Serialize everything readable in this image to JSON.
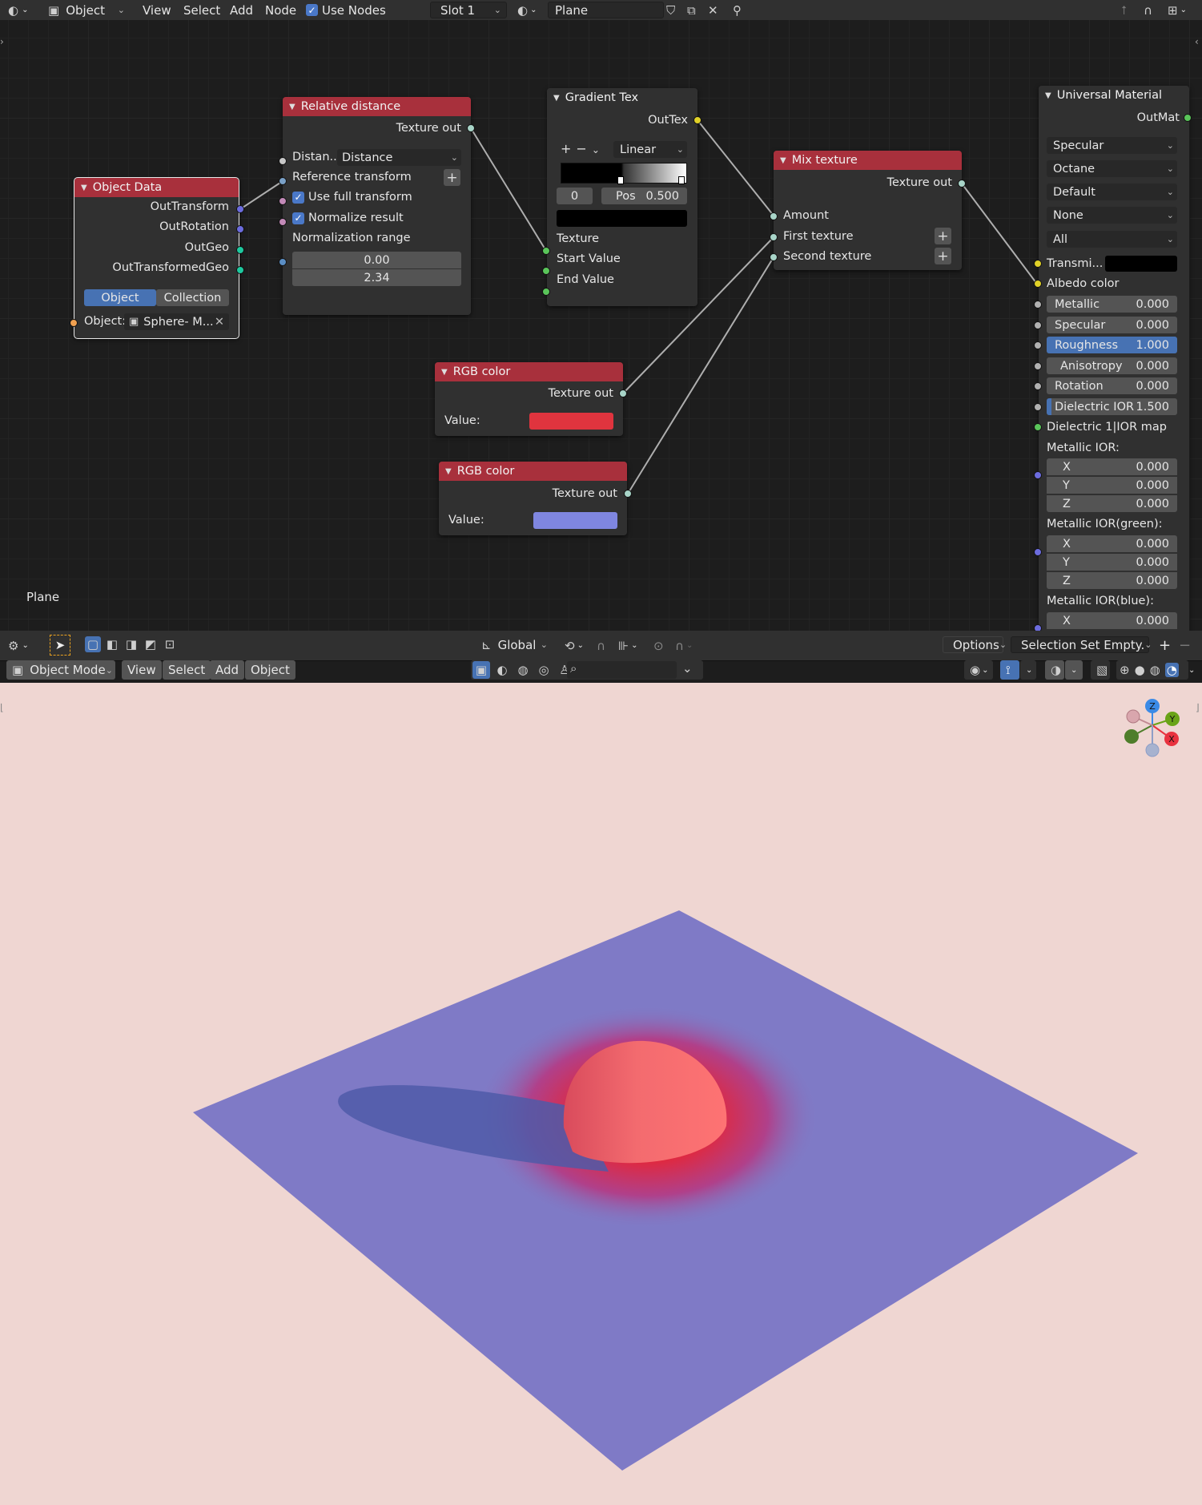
{
  "topbar": {
    "mode_label": "Object",
    "menu": [
      "View",
      "Select",
      "Add",
      "Node"
    ],
    "use_nodes_label": "Use Nodes",
    "slot_label": "Slot 1",
    "material_name": "Plane"
  },
  "node_editor": {
    "object_name_label": "Plane",
    "nodes": {
      "object_data": {
        "title": "Object Data",
        "outputs": [
          "OutTransform",
          "OutRotation",
          "OutGeo",
          "OutTransformedGeo"
        ],
        "tab_object": "Object",
        "tab_collection": "Collection",
        "object_label": "Object:",
        "object_value": "Sphere- M..."
      },
      "relative_distance": {
        "title": "Relative distance",
        "output": "Texture out",
        "distance_label": "Distan...",
        "distance_value": "Distance",
        "reference_transform": "Reference transform",
        "use_full_transform": "Use full transform",
        "normalize_result": "Normalize result",
        "normalization_range": "Normalization range",
        "range_min": "0.00",
        "range_max": "2.34"
      },
      "gradient_tex": {
        "title": "Gradient Tex",
        "output": "OutTex",
        "interp": "Linear",
        "index": "0",
        "pos_label": "Pos",
        "pos_value": "0.500",
        "inputs": [
          "Texture",
          "Start Value",
          "End Value"
        ]
      },
      "mix_texture": {
        "title": "Mix texture",
        "output": "Texture out",
        "inputs": [
          "Amount",
          "First texture",
          "Second texture"
        ]
      },
      "rgb1": {
        "title": "RGB color",
        "output": "Texture out",
        "value_label": "Value:",
        "color": "#e0343e"
      },
      "rgb2": {
        "title": "RGB color",
        "output": "Texture out",
        "value_label": "Value:",
        "color": "#7f86e0"
      },
      "universal": {
        "title": "Universal Material",
        "output": "OutMat",
        "dropdowns": [
          "Specular",
          "Octane",
          "Default",
          "None",
          "All"
        ],
        "transmission_label": "Transmi...",
        "albedo_label": "Albedo color",
        "params": [
          {
            "label": "Metallic",
            "value": "0.000"
          },
          {
            "label": "Specular",
            "value": "0.000"
          },
          {
            "label": "Roughness",
            "value": "1.000"
          },
          {
            "label": "Anisotropy",
            "value": "0.000"
          },
          {
            "label": "Rotation",
            "value": "0.000"
          },
          {
            "label": "Dielectric IOR",
            "value": "1.500"
          }
        ],
        "ior_map_label": "Dielectric 1|IOR map",
        "metallic_ior_label": "Metallic IOR:",
        "metallic_ior_green_label": "Metallic IOR(green):",
        "metallic_ior_blue_label": "Metallic IOR(blue):",
        "xyz": {
          "x": "X",
          "y": "Y",
          "z": "Z",
          "value": "0.000"
        }
      }
    }
  },
  "node_footer": {
    "orientation": "Global",
    "options_label": "Options",
    "selection_set": "Selection Set Empty."
  },
  "viewport_header": {
    "mode_label": "Object Mode",
    "menu": [
      "View",
      "Select",
      "Add",
      "Object"
    ]
  },
  "gizmo": {
    "z": "Z",
    "y": "Y",
    "x": "X"
  },
  "colors": {
    "accent": "#4772b3",
    "node_header": "#a8303c",
    "viewport_bg": "#efd6d2",
    "plane": "#7f7ac6"
  }
}
